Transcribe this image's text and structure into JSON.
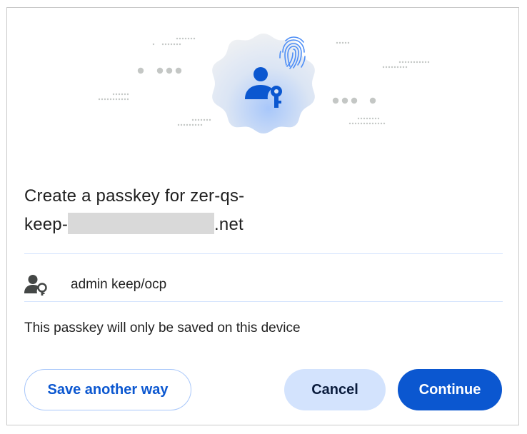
{
  "dialog": {
    "title_prefix": "Create a passkey for zer-qs-\nkeep-",
    "title_suffix": ".net",
    "account": {
      "name": "admin keep/ocp",
      "icon": "person-key-icon"
    },
    "note": "This passkey will only be saved on this device",
    "buttons": {
      "save_another_way": "Save another way",
      "cancel": "Cancel",
      "continue": "Continue"
    }
  },
  "hero": {
    "badge_icon": "person-key-icon",
    "corner_icon": "fingerprint-icon"
  },
  "colors": {
    "primary": "#0b57d0",
    "tonal": "#d3e3fd",
    "outline": "#a8c7fa",
    "text": "#1f1f1f",
    "redaction": "#d9d9d9"
  }
}
